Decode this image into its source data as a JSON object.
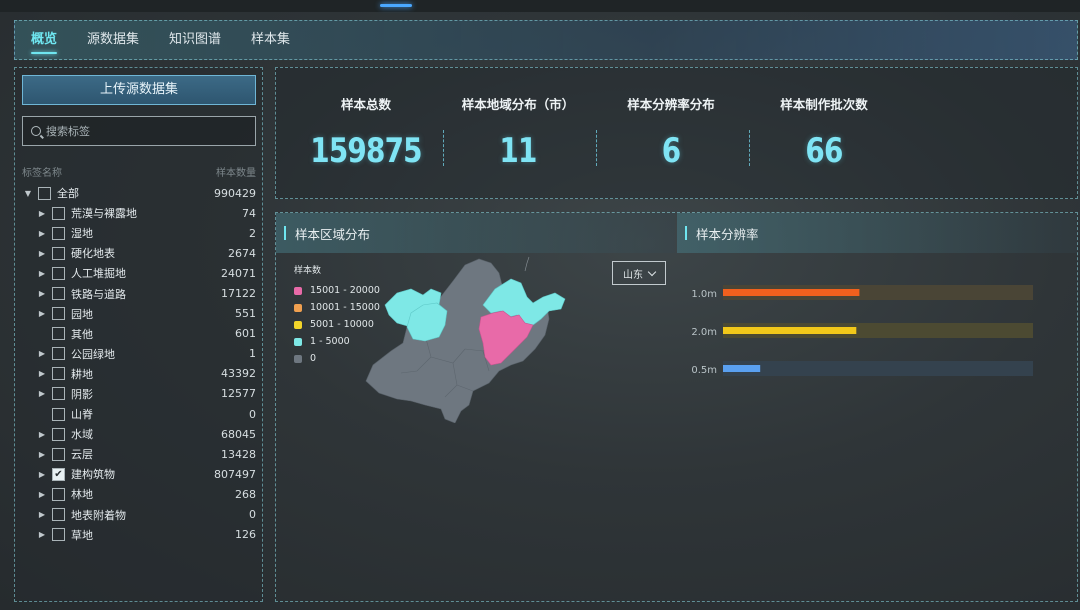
{
  "nav": {
    "tabs": [
      {
        "label": "概览",
        "active": true
      },
      {
        "label": "源数据集",
        "active": false
      },
      {
        "label": "知识图谱",
        "active": false
      },
      {
        "label": "样本集",
        "active": false
      }
    ]
  },
  "sidebar": {
    "upload_label": "上传源数据集",
    "search_placeholder": "搜索标签",
    "col_name": "标签名称",
    "col_count": "样本数量",
    "items": [
      {
        "label": "全部",
        "count": "990429",
        "expanded": true,
        "checked": false,
        "root": true
      },
      {
        "label": "荒漠与裸露地",
        "count": "74",
        "expandable": true,
        "checked": false
      },
      {
        "label": "湿地",
        "count": "2",
        "expandable": true,
        "checked": false
      },
      {
        "label": "硬化地表",
        "count": "2674",
        "expandable": true,
        "checked": false
      },
      {
        "label": "人工堆掘地",
        "count": "24071",
        "expandable": true,
        "checked": false
      },
      {
        "label": "铁路与道路",
        "count": "17122",
        "expandable": true,
        "checked": false
      },
      {
        "label": "园地",
        "count": "551",
        "expandable": true,
        "checked": false
      },
      {
        "label": "其他",
        "count": "601",
        "expandable": false,
        "checked": false
      },
      {
        "label": "公园绿地",
        "count": "1",
        "expandable": true,
        "checked": false
      },
      {
        "label": "耕地",
        "count": "43392",
        "expandable": true,
        "checked": false
      },
      {
        "label": "阴影",
        "count": "12577",
        "expandable": true,
        "checked": false
      },
      {
        "label": "山脊",
        "count": "0",
        "expandable": false,
        "checked": false
      },
      {
        "label": "水域",
        "count": "68045",
        "expandable": true,
        "checked": false
      },
      {
        "label": "云层",
        "count": "13428",
        "expandable": true,
        "checked": false
      },
      {
        "label": "建构筑物",
        "count": "807497",
        "expandable": true,
        "checked": true
      },
      {
        "label": "林地",
        "count": "268",
        "expandable": true,
        "checked": false
      },
      {
        "label": "地表附着物",
        "count": "0",
        "expandable": true,
        "checked": false
      },
      {
        "label": "草地",
        "count": "126",
        "expandable": true,
        "checked": false
      }
    ]
  },
  "stats": [
    {
      "title": "样本总数",
      "value": "159875"
    },
    {
      "title": "样本地域分布（市）",
      "value": "11"
    },
    {
      "title": "样本分辨率分布",
      "value": "6"
    },
    {
      "title": "样本制作批次数",
      "value": "66"
    }
  ],
  "region": {
    "title": "样本区域分布",
    "legend_title": "样本数",
    "legend": [
      {
        "label": "15001 - 20000",
        "color": "#e86aa8"
      },
      {
        "label": "10001 - 15000",
        "color": "#f0a050"
      },
      {
        "label": "5001 - 10000",
        "color": "#f2d52a"
      },
      {
        "label": "1 - 5000",
        "color": "#7ee8e6"
      },
      {
        "label": "0",
        "color": "#6e7780"
      }
    ],
    "province": "山东"
  },
  "chart_data": {
    "type": "bar",
    "orientation": "horizontal",
    "title": "样本分辨率",
    "categories": [
      "1.0m",
      "2.0m",
      "0.5m"
    ],
    "values": [
      0.44,
      0.43,
      0.12
    ],
    "xlim": [
      0,
      1
    ],
    "colors": [
      "#f0601e",
      "#f2c81a",
      "#5aa0f0"
    ],
    "track_colors": [
      "#4a4536",
      "#4c4a32",
      "#34424e"
    ],
    "grid": false,
    "legend": "none"
  }
}
